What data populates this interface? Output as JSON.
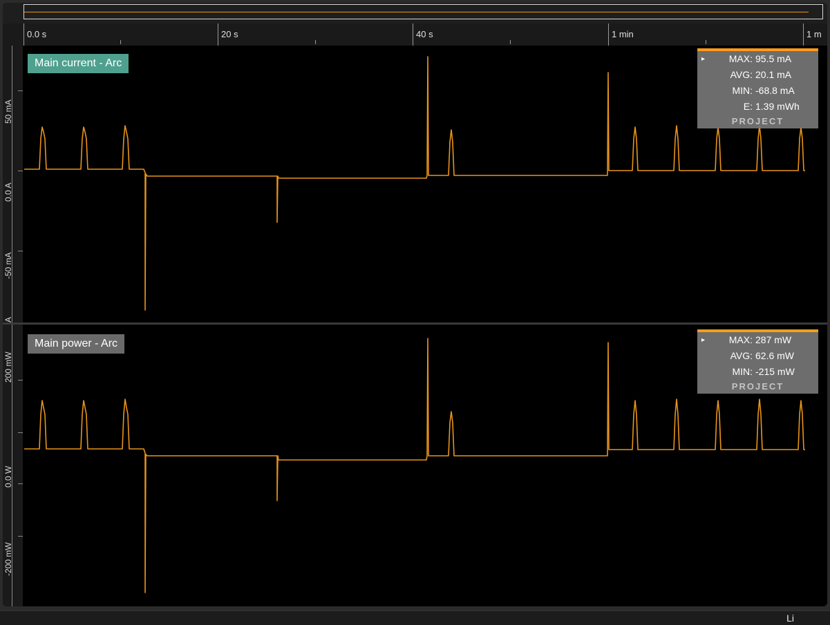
{
  "time_axis": {
    "labels": [
      "0.0 s",
      "20 s",
      "40 s",
      "1 min",
      "1 m"
    ]
  },
  "panes": [
    {
      "title": "Main current - Arc",
      "title_bg": "#4fa08f",
      "y_labels": [
        "50 mA",
        "0.0 A",
        "-50 mA",
        "A"
      ],
      "stats": [
        {
          "key": "MAX:",
          "value": "95.5 mA"
        },
        {
          "key": "AVG:",
          "value": "20.1 mA"
        },
        {
          "key": "MIN:",
          "value": "-68.8 mA"
        },
        {
          "key": "E:",
          "value": "1.39 mWh"
        }
      ],
      "project_label": "PROJECT"
    },
    {
      "title": "Main power - Arc",
      "title_bg": "#6a6a6a",
      "y_labels": [
        "200 mW",
        "0.0 W",
        "-200 mW"
      ],
      "stats": [
        {
          "key": "MAX:",
          "value": "287 mW"
        },
        {
          "key": "AVG:",
          "value": "62.6 mW"
        },
        {
          "key": "MIN:",
          "value": "-215 mW"
        }
      ],
      "project_label": "PROJECT"
    }
  ],
  "colors": {
    "trace": "#e8941a",
    "stats_accent": "#ff9c1a"
  },
  "status_bar": {
    "text": "Li"
  }
}
